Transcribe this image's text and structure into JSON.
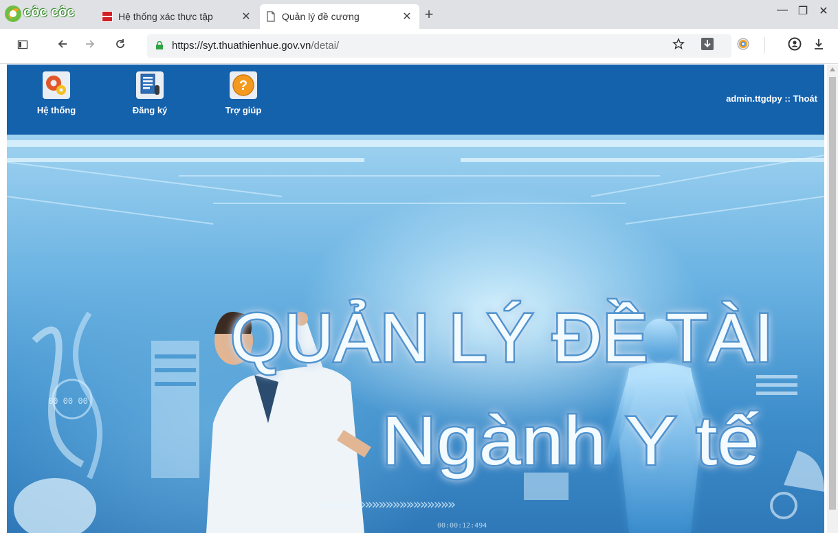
{
  "browser": {
    "brand_logo_text": "côc côc",
    "tabs": [
      {
        "title": "Hệ thống xác thực tập",
        "favicon": "sso-hue-icon",
        "active": false,
        "close": "✕"
      },
      {
        "title": "Quản lý đề cương",
        "favicon": "document-icon",
        "active": true,
        "close": "✕"
      }
    ],
    "new_tab": "+",
    "window_controls": {
      "minimize": "—",
      "restore": "❐",
      "close": "✕"
    },
    "toolbar": {
      "url_host": "https://syt.thuathienhue.gov.vn",
      "url_path": "/detai/",
      "icons": [
        "sidebar-icon",
        "back-icon",
        "forward-icon",
        "reload-icon",
        "lock-icon",
        "star-icon",
        "save-page-icon",
        "coccoc-extension-icon",
        "account-icon",
        "download-icon"
      ]
    }
  },
  "nav": {
    "items": [
      {
        "label": "Hệ thống",
        "icon": "settings-gears-icon"
      },
      {
        "label": "Đăng ký",
        "icon": "register-document-icon"
      },
      {
        "label": "Trợ giúp",
        "icon": "help-question-icon"
      }
    ],
    "user": "admin.ttgdpy",
    "separator": "::",
    "logout": "Thoát",
    "bar_color": "#1461ac"
  },
  "banner": {
    "line1": "QUẢN LÝ ĐỀ TÀI",
    "line2": "Ngành Y tế",
    "hud_time": "00:00:12:494",
    "hud_counter": "00 00 00"
  }
}
